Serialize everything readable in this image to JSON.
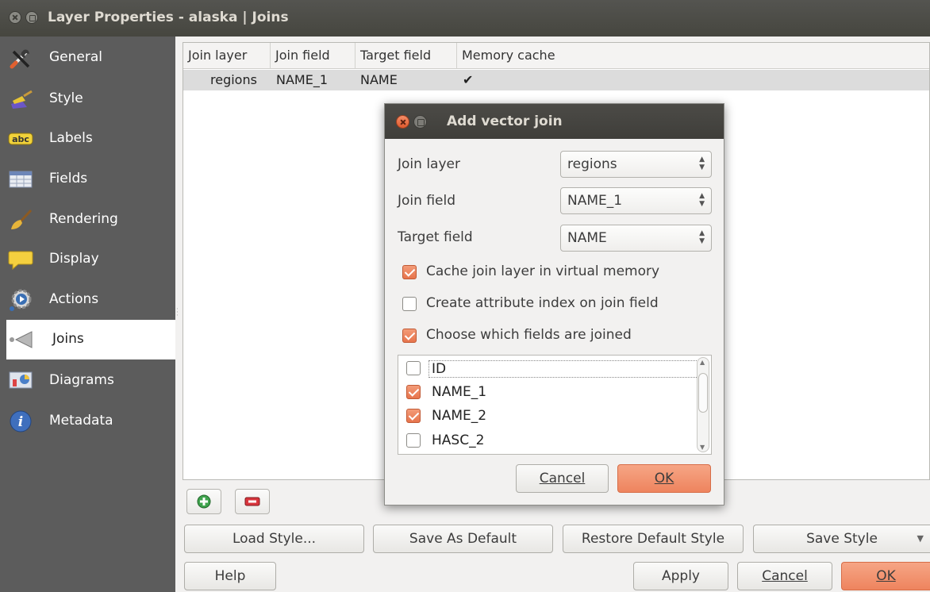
{
  "window": {
    "title": "Layer Properties - alaska | Joins"
  },
  "sidebar": {
    "items": [
      {
        "label": "General",
        "icon": "wrench-screwdriver-icon"
      },
      {
        "label": "Style",
        "icon": "paint-brush-icon"
      },
      {
        "label": "Labels",
        "icon": "abc-label-icon",
        "icon_text": "abc"
      },
      {
        "label": "Fields",
        "icon": "table-icon"
      },
      {
        "label": "Rendering",
        "icon": "brush-icon"
      },
      {
        "label": "Display",
        "icon": "speech-bubble-icon"
      },
      {
        "label": "Actions",
        "icon": "gear-action-icon"
      },
      {
        "label": "Joins",
        "icon": "join-icon",
        "active": true
      },
      {
        "label": "Diagrams",
        "icon": "diagram-icon"
      },
      {
        "label": "Metadata",
        "icon": "info-icon",
        "icon_text": "i"
      }
    ]
  },
  "joins_table": {
    "columns": [
      "Join layer",
      "Join field",
      "Target field",
      "Memory cache"
    ],
    "rows": [
      {
        "join_layer": "regions",
        "join_field": "NAME_1",
        "target_field": "NAME",
        "memory_cache": "✔"
      }
    ]
  },
  "dialog": {
    "title": "Add vector join",
    "join_layer": {
      "label": "Join layer",
      "value": "regions"
    },
    "join_field": {
      "label": "Join field",
      "value": "NAME_1"
    },
    "target_field": {
      "label": "Target field",
      "value": "NAME"
    },
    "options": [
      {
        "label": "Cache join layer in virtual memory",
        "checked": true
      },
      {
        "label": "Create attribute index on join field",
        "checked": false
      },
      {
        "label": "Choose which fields are joined",
        "checked": true
      }
    ],
    "fields": [
      {
        "label": "ID",
        "checked": false
      },
      {
        "label": "NAME_1",
        "checked": true
      },
      {
        "label": "NAME_2",
        "checked": true
      },
      {
        "label": "HASC_2",
        "checked": false
      }
    ],
    "cancel_label": "Cancel",
    "ok_label": "OK"
  },
  "style_buttons": {
    "load": "Load Style...",
    "save_default": "Save As Default",
    "restore_default": "Restore Default Style",
    "save_style": "Save Style"
  },
  "bottom_buttons": {
    "help": "Help",
    "apply": "Apply",
    "cancel": "Cancel",
    "ok": "OK"
  },
  "colors": {
    "accent": "#ef8a62",
    "sidebar_bg": "#5c5c5c",
    "titlebar_bg": "#4a4a44"
  }
}
